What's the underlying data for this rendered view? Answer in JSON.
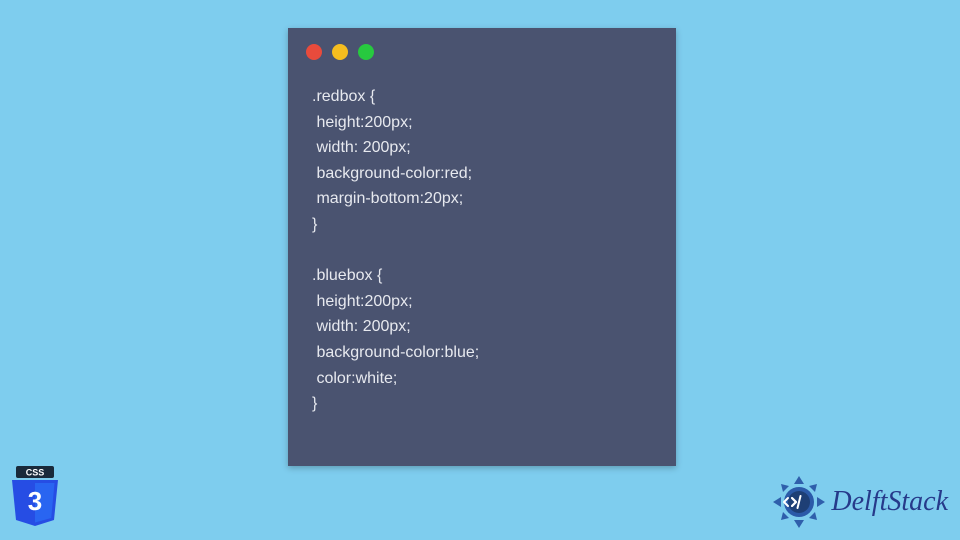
{
  "code_window": {
    "code": ".redbox {\n height:200px;\n width: 200px;\n background-color:red;\n margin-bottom:20px;\n}\n\n.bluebox {\n height:200px;\n width: 200px;\n background-color:blue;\n color:white;\n}"
  },
  "css_badge": {
    "label": "CSS",
    "version": "3"
  },
  "footer_logo": {
    "text": "DelftStack"
  },
  "traffic_lights": {
    "red": "#e84b3c",
    "yellow": "#f5bd1f",
    "green": "#27c93f"
  }
}
